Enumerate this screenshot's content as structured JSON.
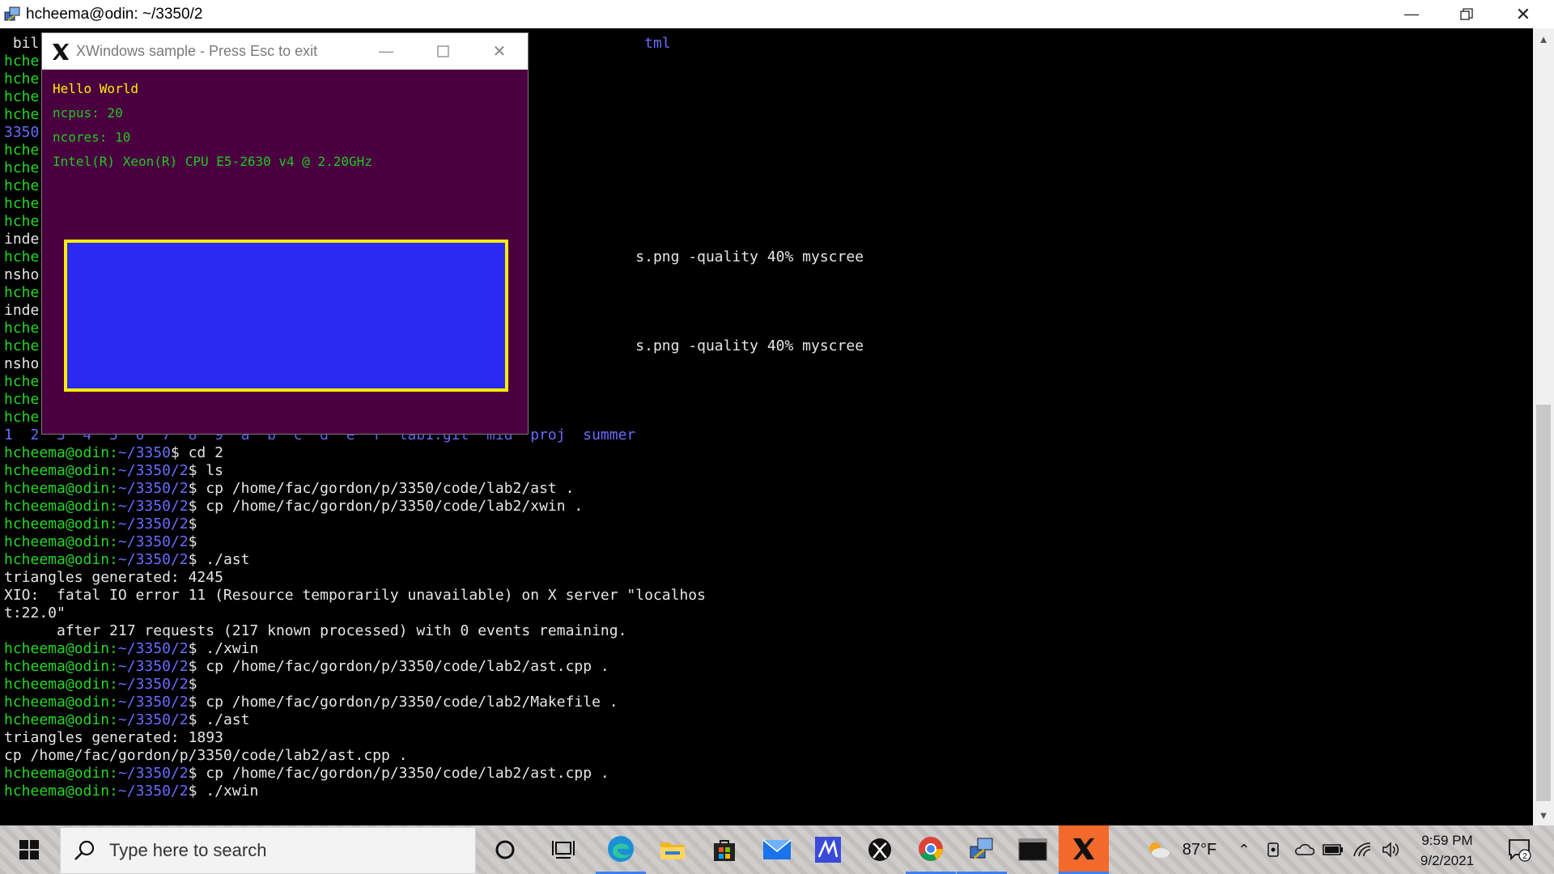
{
  "window": {
    "title": "hcheema@odin: ~/3350/2",
    "minimize_icon": "minimize-icon",
    "maximize_icon": "restore-icon",
    "close_icon": "close-icon"
  },
  "terminal": {
    "lines": [
      {
        "type": "plain",
        "p": " bil",
        "cmd": "                                                                     tml"
      },
      {
        "type": "prompt",
        "p": "hche",
        "cmd": ""
      },
      {
        "type": "prompt",
        "p": "hche",
        "cmd": ""
      },
      {
        "type": "prompt",
        "p": "hche",
        "cmd": ""
      },
      {
        "type": "prompt",
        "p": "hche",
        "cmd": ""
      },
      {
        "type": "blue",
        "p": "3350",
        "cmd": ""
      },
      {
        "type": "prompt",
        "p": "hche",
        "cmd": ""
      },
      {
        "type": "prompt",
        "p": "hche",
        "cmd": ""
      },
      {
        "type": "prompt",
        "p": "hche",
        "cmd": ""
      },
      {
        "type": "prompt",
        "p": "hche",
        "cmd": ""
      },
      {
        "type": "prompt",
        "p": "hche",
        "cmd": ""
      },
      {
        "type": "plain",
        "p": "inde",
        "cmd": ""
      },
      {
        "type": "prompt",
        "p": "hche",
        "cmd": "                                                                    s.png -quality 40% myscree"
      },
      {
        "type": "plain",
        "p": "nsho",
        "cmd": ""
      },
      {
        "type": "prompt",
        "p": "hche",
        "cmd": ""
      },
      {
        "type": "plain",
        "p": "inde",
        "cmd": ""
      },
      {
        "type": "prompt",
        "p": "hche",
        "cmd": ""
      },
      {
        "type": "prompt",
        "p": "hche",
        "cmd": "                                                                    s.png -quality 40% myscree"
      },
      {
        "type": "plain",
        "p": "nsho",
        "cmd": ""
      },
      {
        "type": "prompt",
        "p": "hche",
        "cmd": ""
      },
      {
        "type": "prompt",
        "p": "hche",
        "cmd": ""
      },
      {
        "type": "prompt",
        "p": "hche",
        "cmd": ""
      },
      {
        "type": "blue",
        "p": "1  2  3  4  5  6  7  8  9  a  b  c  d  e  f  lab1.git  mid  proj  summer",
        "cmd": ""
      },
      {
        "type": "full",
        "user": "hcheema@odin:",
        "path": "~/3350",
        "cmd": "$ cd 2"
      },
      {
        "type": "full",
        "user": "hcheema@odin:",
        "path": "~/3350/2",
        "cmd": "$ ls"
      },
      {
        "type": "full",
        "user": "hcheema@odin:",
        "path": "~/3350/2",
        "cmd": "$ cp /home/fac/gordon/p/3350/code/lab2/ast ."
      },
      {
        "type": "full",
        "user": "hcheema@odin:",
        "path": "~/3350/2",
        "cmd": "$ cp /home/fac/gordon/p/3350/code/lab2/xwin ."
      },
      {
        "type": "full",
        "user": "hcheema@odin:",
        "path": "~/3350/2",
        "cmd": "$"
      },
      {
        "type": "full",
        "user": "hcheema@odin:",
        "path": "~/3350/2",
        "cmd": "$"
      },
      {
        "type": "full",
        "user": "hcheema@odin:",
        "path": "~/3350/2",
        "cmd": "$ ./ast"
      },
      {
        "type": "out",
        "text": "triangles generated: 4245"
      },
      {
        "type": "out",
        "text": "XIO:  fatal IO error 11 (Resource temporarily unavailable) on X server \"localhos"
      },
      {
        "type": "out",
        "text": "t:22.0\""
      },
      {
        "type": "out",
        "text": "      after 217 requests (217 known processed) with 0 events remaining."
      },
      {
        "type": "full",
        "user": "hcheema@odin:",
        "path": "~/3350/2",
        "cmd": "$ ./xwin"
      },
      {
        "type": "full",
        "user": "hcheema@odin:",
        "path": "~/3350/2",
        "cmd": "$ cp /home/fac/gordon/p/3350/code/lab2/ast.cpp ."
      },
      {
        "type": "full",
        "user": "hcheema@odin:",
        "path": "~/3350/2",
        "cmd": "$"
      },
      {
        "type": "full",
        "user": "hcheema@odin:",
        "path": "~/3350/2",
        "cmd": "$ cp /home/fac/gordon/p/3350/code/lab2/Makefile ."
      },
      {
        "type": "full",
        "user": "hcheema@odin:",
        "path": "~/3350/2",
        "cmd": "$ ./ast"
      },
      {
        "type": "out",
        "text": "triangles generated: 1893"
      },
      {
        "type": "out",
        "text": "cp /home/fac/gordon/p/3350/code/lab2/ast.cpp ."
      },
      {
        "type": "full",
        "user": "hcheema@odin:",
        "path": "~/3350/2",
        "cmd": "$ cp /home/fac/gordon/p/3350/code/lab2/ast.cpp ."
      },
      {
        "type": "full",
        "user": "hcheema@odin:",
        "path": "~/3350/2",
        "cmd": "$ ./xwin"
      }
    ]
  },
  "xwindow": {
    "title": "XWindows sample  -   Press Esc to exit",
    "text_hello": "Hello World",
    "text_ncpus": "ncpus: 20",
    "text_ncores": "ncores: 10",
    "text_cpu": "Intel(R) Xeon(R) CPU E5-2630 v4 @ 2.20GHz",
    "colors": {
      "bg": "#4a0040",
      "rect": "#2a2af0",
      "rect_border": "#ffee00",
      "hello": "#ffee00",
      "info": "#22c722"
    }
  },
  "taskbar": {
    "search_placeholder": "Type here to search",
    "weather_temp": "87°F",
    "time": "9:59 PM",
    "date": "9/2/2021",
    "notification_count": "2",
    "pinned": [
      "cortana-icon",
      "task-view-icon",
      "edge-icon",
      "file-explorer-icon",
      "store-icon",
      "mail-icon",
      "app-icon",
      "xbox-icon",
      "chrome-icon",
      "putty-icon",
      "terminal-icon",
      "xming-icon"
    ]
  }
}
